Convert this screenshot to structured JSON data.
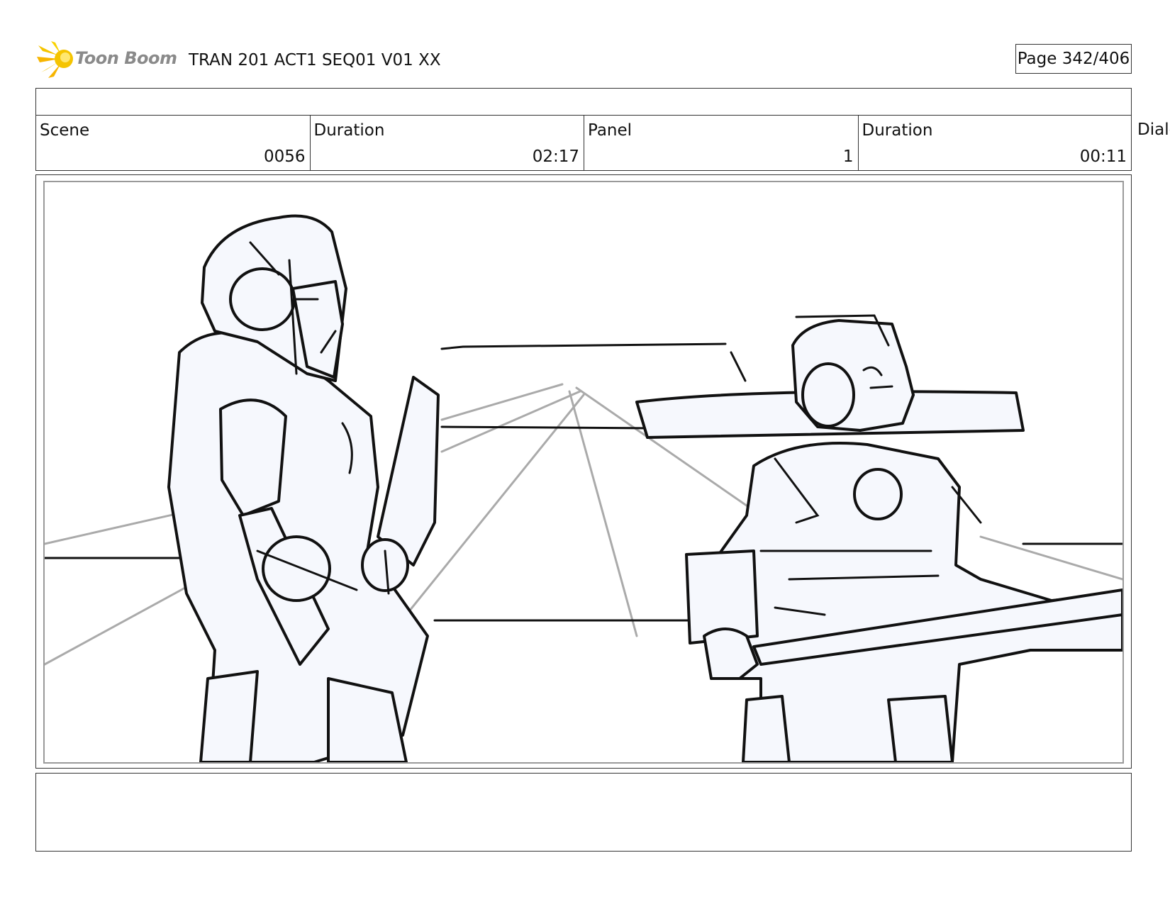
{
  "header": {
    "logo_text": "Toon Boom",
    "document_title": "TRAN 201 ACT1 SEQ01 V01 XX",
    "page_indicator": "Page 342/406"
  },
  "info_row": {
    "scene_label": "Scene",
    "scene_value": "0056",
    "scene_duration_label": "Duration",
    "scene_duration_value": "02:17",
    "panel_label": "Panel",
    "panel_value": "1",
    "panel_duration_label": "Duration",
    "panel_duration_value": "00:11",
    "dialog_label": "Dialog"
  },
  "panel_image": {
    "icon": "storyboard-sketch-two-robots"
  },
  "colors": {
    "logo_accent": "#f5c400",
    "sketch_line": "#111111",
    "perspective_line": "#aaaaaa",
    "figure_fill": "#f6f8fd"
  }
}
